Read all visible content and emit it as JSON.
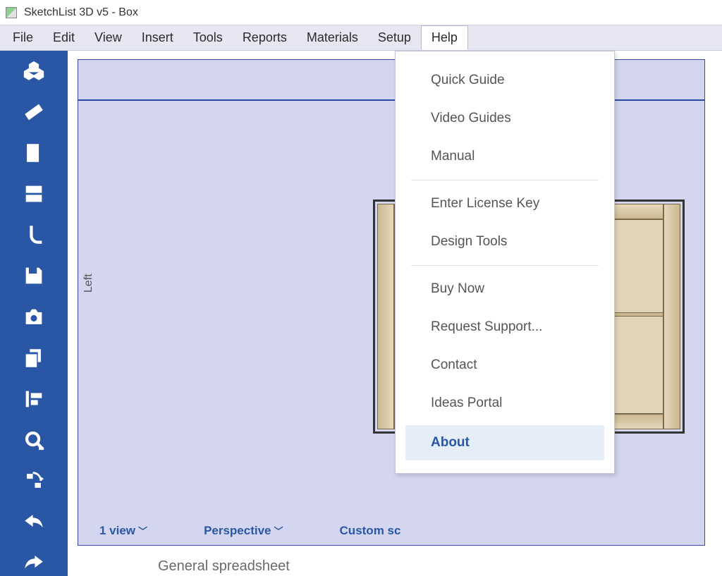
{
  "window": {
    "title": "SketchList 3D v5 - Box"
  },
  "menubar": {
    "items": [
      "File",
      "Edit",
      "View",
      "Insert",
      "Tools",
      "Reports",
      "Materials",
      "Setup",
      "Help"
    ],
    "active_index": 8
  },
  "help_menu": {
    "groups": [
      [
        "Quick Guide",
        "Video Guides",
        "Manual"
      ],
      [
        "Enter License Key",
        "Design Tools"
      ],
      [
        "Buy Now",
        "Request Support...",
        "Contact",
        "Ideas Portal"
      ]
    ],
    "highlighted": "About"
  },
  "sidebar": {
    "tools": [
      "assemblies-icon",
      "board-icon",
      "door-icon",
      "drawer-icon",
      "handle-icon",
      "save-icon",
      "camera-icon",
      "copy-icon",
      "align-left-icon",
      "measure-icon",
      "rotate-icon",
      "undo-icon",
      "redo-icon"
    ]
  },
  "viewport": {
    "axis_label": "Left",
    "status": {
      "views": "1 view",
      "projection": "Perspective",
      "scale_label": "Custom sc"
    }
  },
  "footer": {
    "panel_title": "General spreadsheet"
  },
  "colors": {
    "brand_blue": "#2a57a5",
    "canvas_lavender": "#d4d6ef"
  }
}
